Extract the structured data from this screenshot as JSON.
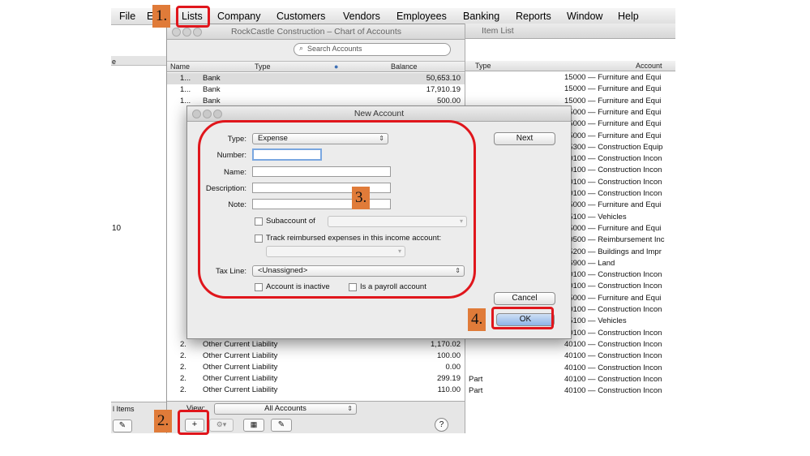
{
  "menubar": {
    "items": [
      "File",
      "E",
      "Lists",
      "Company",
      "Customers",
      "Vendors",
      "Employees",
      "Banking",
      "Reports",
      "Window",
      "Help"
    ]
  },
  "chart_of_accounts": {
    "title": "RockCastle Construction – Chart of Accounts",
    "search_placeholder": "Search Accounts",
    "columns": [
      "Name",
      "Type",
      "Balance"
    ],
    "rows": [
      {
        "name": "1...",
        "type": "Bank",
        "balance": "50,653.10"
      },
      {
        "name": "1...",
        "type": "Bank",
        "balance": "17,910.19"
      },
      {
        "name": "1...",
        "type": "Bank",
        "balance": "500.00"
      },
      {
        "name": "2.",
        "type": "Other Current Liability",
        "balance": "1,170.02"
      },
      {
        "name": "2.",
        "type": "Other Current Liability",
        "balance": "100.00"
      },
      {
        "name": "2.",
        "type": "Other Current Liability",
        "balance": "0.00"
      },
      {
        "name": "2.",
        "type": "Other Current Liability",
        "balance": "299.19"
      },
      {
        "name": "2.",
        "type": "Other Current Liability",
        "balance": "110.00"
      }
    ],
    "footer": {
      "view_label": "View:",
      "view_value": "All Accounts"
    }
  },
  "left_panel": {
    "side_text_1": "e",
    "side_text_2": "10",
    "items_label": "l Items"
  },
  "item_list": {
    "title": "Item List",
    "columns": [
      "Type",
      "Account"
    ],
    "rows": [
      {
        "type": "",
        "account": "15000 — Furniture and Equi"
      },
      {
        "type": "",
        "account": "15000 — Furniture and Equi"
      },
      {
        "type": "",
        "account": "15000 — Furniture and Equi"
      },
      {
        "type": "",
        "account": "15000 — Furniture and Equi"
      },
      {
        "type": "",
        "account": "15000 — Furniture and Equi"
      },
      {
        "type": "",
        "account": "15000 — Furniture and Equi"
      },
      {
        "type": "",
        "account": "15300 — Construction Equip"
      },
      {
        "type": "",
        "account": "40100 — Construction Incon"
      },
      {
        "type": "",
        "account": "40100 — Construction Incon"
      },
      {
        "type": "",
        "account": "40100 — Construction Incon"
      },
      {
        "type": "",
        "account": "40100 — Construction Incon"
      },
      {
        "type": "",
        "account": "15000 — Furniture and Equi"
      },
      {
        "type": "",
        "account": "15100 — Vehicles"
      },
      {
        "type": "",
        "account": "15000 — Furniture and Equi"
      },
      {
        "type": "",
        "account": "40500 — Reimbursement Inc"
      },
      {
        "type": "",
        "account": "15200 — Buildings and Impr"
      },
      {
        "type": "",
        "account": "16900 — Land"
      },
      {
        "type": "",
        "account": "40100 — Construction Incon"
      },
      {
        "type": "",
        "account": "40100 — Construction Incon"
      },
      {
        "type": "",
        "account": "15000 — Furniture and Equi"
      },
      {
        "type": "",
        "account": "40100 — Construction Incon"
      },
      {
        "type": "",
        "account": "15100 — Vehicles"
      },
      {
        "type": "",
        "account": "40100 — Construction Incon"
      },
      {
        "type": "",
        "account": "40100 — Construction Incon"
      },
      {
        "type": "",
        "account": "40100 — Construction Incon"
      },
      {
        "type": "",
        "account": "40100 — Construction Incon"
      },
      {
        "type": "Part",
        "account": "40100 — Construction Incon"
      },
      {
        "type": "Part",
        "account": "40100 — Construction Incon"
      }
    ]
  },
  "dialog": {
    "title": "New Account",
    "type_label": "Type:",
    "type_value": "Expense",
    "number_label": "Number:",
    "name_label": "Name:",
    "description_label": "Description:",
    "note_label": "Note:",
    "subaccount_label": "Subaccount of",
    "track_label": "Track reimbursed expenses in this income account:",
    "tax_line_label": "Tax Line:",
    "tax_line_value": "<Unassigned>",
    "inactive_label": "Account is inactive",
    "payroll_label": "Is a payroll account",
    "next_button": "Next",
    "cancel_button": "Cancel",
    "ok_button": "OK"
  },
  "annotations": {
    "step1": "1.",
    "step2": "2.",
    "step3": "3.",
    "step4": "4."
  },
  "colors": {
    "annotation_red": "#e0161c",
    "badge_orange": "#e07b39"
  }
}
